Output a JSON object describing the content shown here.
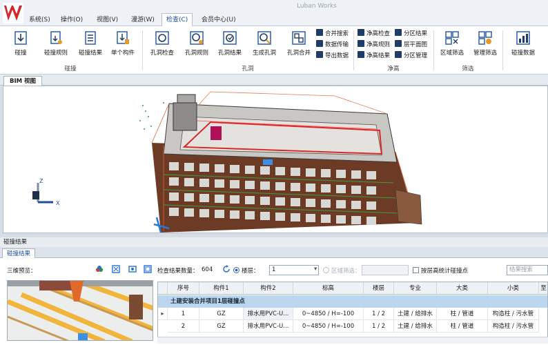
{
  "app": {
    "title": "Luban Works"
  },
  "menu_tabs": [
    "系统(S)",
    "操作(O)",
    "视图(V)",
    "漫游(W)",
    "检查(C)",
    "会员中心(U)"
  ],
  "ribbon": {
    "clash_group": {
      "label": "碰撞",
      "buttons": [
        "碰撞",
        "碰撞规则",
        "碰撞结果",
        "单个构件"
      ]
    },
    "hole_group": {
      "label": "孔洞",
      "buttons": [
        "孔洞检查",
        "孔洞规则",
        "孔洞结果",
        "生成孔洞",
        "孔洞合并"
      ],
      "small": [
        "合并搜索",
        "数据传输",
        "导出数据"
      ]
    },
    "clear_group": {
      "label": "净高",
      "small": [
        "净高检查",
        "净高规则",
        "净高结果",
        "分区结果",
        "层平面图",
        "分区管理"
      ]
    },
    "filter_group": {
      "label": "筛选",
      "buttons": [
        "区域筛选",
        "管理筛选"
      ]
    },
    "data_group": {
      "buttons": [
        "碰撞数据"
      ]
    }
  },
  "view_tab": "BIM 视图",
  "axis": {
    "z": "Z",
    "x": "X"
  },
  "panel": {
    "title": "碰撞结果",
    "tab": "碰撞结果",
    "preview_label": "三维预览：",
    "count_label": "检查结果数量：",
    "count_value": "604",
    "floor_label": "楼层：",
    "floor_value": "1",
    "zone_label": "区域筛选：",
    "stat_label": "按层高统计碰撞点",
    "search_placeholder": "结果搜索"
  },
  "table": {
    "columns": [
      "序号",
      "构件1",
      "构件2",
      "标高",
      "楼层",
      "专业",
      "大类",
      "小类",
      "至"
    ],
    "group": "土建安装合并项目1层碰撞点",
    "rows": [
      [
        "1",
        "GZ",
        "排水用PVC-U...",
        "0~4850 / H=-100",
        "1 / 2",
        "土建 / 给排水",
        "柱 / 管道",
        "构造柱 / 污水管"
      ],
      [
        "2",
        "GZ",
        "排水用PVC-U...",
        "0~4850 / H=-100",
        "1 / 2",
        "土建 / 给排水",
        "柱 / 管道",
        "构造柱 / 污水管"
      ]
    ]
  },
  "colors": {
    "accent": "#1a4f9c",
    "logo": "#d4262b",
    "group_row": "#bcd6f0"
  }
}
